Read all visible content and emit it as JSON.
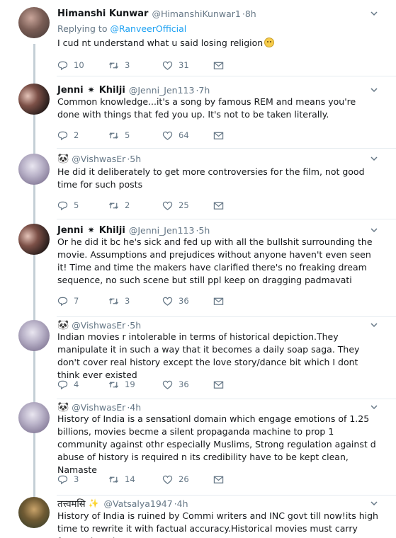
{
  "colors": {
    "link": "#1da1f2",
    "muted": "#657786",
    "thread": "#c4cfd6"
  },
  "icons": {
    "reply": "reply-icon",
    "retweet": "retweet-icon",
    "like": "heart-icon",
    "dm": "envelope-icon",
    "menu": "chevron-down-icon"
  },
  "tweets": [
    {
      "name": "Himanshi Kunwar",
      "handle": "@HimanshiKunwar1",
      "time": "·8h",
      "replying_label": "Replying to ",
      "replying_handle": "@RanveerOfficial",
      "text": "I cud nt understand what u said losing religion",
      "replies": "10",
      "retweets": "3",
      "likes": "31"
    },
    {
      "name_first": "Jenni",
      "name_last": "Khilji",
      "handle": "@Jenni_Jen113",
      "time": "·7h",
      "text": "Common knowledge...it's a song by famous REM and means you're done with things that fed you up. It's not to be taken literally.",
      "replies": "2",
      "retweets": "5",
      "likes": "64"
    },
    {
      "handle": "@VishwasEr",
      "time": "·5h",
      "text": "He did it deliberately to get more controversies for the film, not good time for such posts",
      "replies": "5",
      "retweets": "2",
      "likes": "25"
    },
    {
      "name_first": "Jenni",
      "name_last": "Khilji",
      "handle": "@Jenni_Jen113",
      "time": "·5h",
      "text": "Or he did it bc he's sick and fed up with all the bullshit surrounding the movie. Assumptions and prejudices without anyone haven't even seen it! Time and time the makers have clarified there's no freaking dream sequence, no such scene but still ppl keep on dragging padmavati",
      "replies": "7",
      "retweets": "3",
      "likes": "36"
    },
    {
      "handle": "@VishwasEr",
      "time": "·5h",
      "text": "Indian movies r intolerable in terms of historical depiction.They manipulate it in such a way that it becomes a daily soap saga. They don't cover real history except the love story/dance bit which I dont think ever existed",
      "replies": "4",
      "retweets": "19",
      "likes": "36"
    },
    {
      "handle": "@VishwasEr",
      "time": "·4h",
      "text": "History of India is a sensationl domain which engage emotions of 1.25 billions, movies becme a silent propaganda machine to prop 1 community against othr especially Muslims, Strong regulation against d abuse of history is required n its credibility have to be kept clean, Namaste",
      "replies": "3",
      "retweets": "14",
      "likes": "26"
    },
    {
      "name": "तत्त्वमसि",
      "handle": "@Vatsalya1947",
      "time": "·4h",
      "text": "History of India is ruined by Commi writers and INC govt till now!its high time to rewrite it with factual accuracy.Historical movies must carry facts otherwise"
    }
  ]
}
